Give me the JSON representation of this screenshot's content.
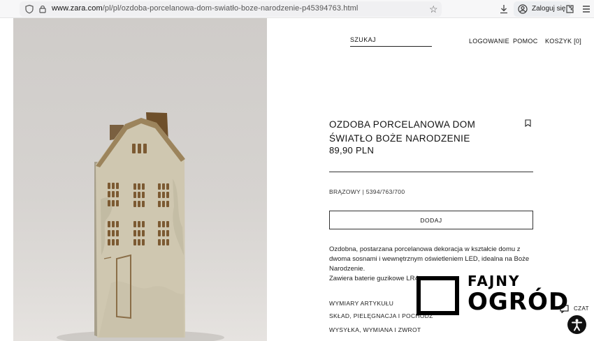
{
  "browser": {
    "url": "www.zara.com/pl/pl/ozdoba-porcelanowa-dom-swiatło-boze-narodzenie-p45394763.html",
    "url_host": "www.zara.com",
    "url_path": "/pl/pl/ozdoba-porcelanowa-dom-swiatło-boze-narodzenie-p45394763.html",
    "sign_in_label": "Zaloguj się",
    "icons": [
      "shield-icon",
      "lock-icon",
      "star-icon",
      "download-icon",
      "avatar-icon",
      "extensions-icon",
      "menu-icon"
    ]
  },
  "header": {
    "search_label": "SZUKAJ",
    "nav": {
      "login": "LOGOWANIE",
      "help": "POMOC",
      "cart": "KOSZYK [0]"
    }
  },
  "product": {
    "title": "OZDOBA PORCELANOWA DOM ŚWIATŁO BOŻE NARODZENIE",
    "price": "89,90 PLN",
    "color_ref": "BRĄZOWY | 5394/763/700",
    "add_button": "DODAJ",
    "description": [
      "Ozdobna, postarzana porcelanowa dekoracja w kształcie domu z dwoma sosnami i wewnętrznym oświetleniem LED, idealna na Boże Narodzenie.",
      "Zawiera baterie guzikowe LR4"
    ],
    "accordion": [
      "WYMIARY ARTYKUŁU",
      "SKŁAD, PIELĘGNACJA I POCHODZ",
      "WYSYŁKA, WYMIANA I ZWROT"
    ]
  },
  "watermark": {
    "line1": "FAJNY",
    "line2": "OGRÓD"
  },
  "chat": {
    "label": "CZAT"
  },
  "colors": {
    "text": "#111111",
    "background": "#ffffff",
    "image_bg": "#d4d1ce",
    "house": "#cfc8b2",
    "roof_glaze": "#8a6a3c"
  }
}
